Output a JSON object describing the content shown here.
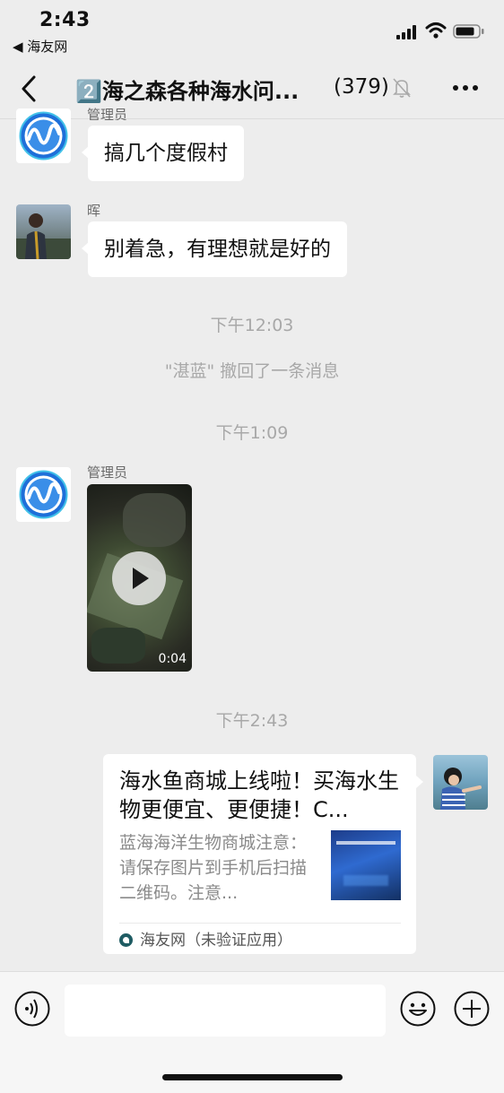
{
  "status_bar": {
    "time": "2:43",
    "back_app": "◀ 海友网"
  },
  "nav": {
    "title": "2️⃣海之森各种海水问...",
    "count": "(379)"
  },
  "messages": {
    "top_sender_partial": "管理员",
    "m1_text": "搞几个度假村",
    "m2_sender": "晖",
    "m2_text": "别着急，有理想就是好的",
    "time1": "下午12:03",
    "recall": "\"湛蓝\" 撤回了一条消息",
    "time2": "下午1:09",
    "m3_sender": "管理员",
    "video_duration": "0:04",
    "time3": "下午2:43"
  },
  "card": {
    "title": "海水鱼商城上线啦！买海水生物更便宜、更便捷！C...",
    "desc": "蓝海海洋生物商城注意：请保存图片到手机后扫描二维码。注意...",
    "source": "海友网（未验证应用）"
  },
  "input": {
    "placeholder": ""
  },
  "colors": {
    "background": "#ededed",
    "bubble": "#ffffff",
    "logo_blue": "#1e6fd9"
  }
}
